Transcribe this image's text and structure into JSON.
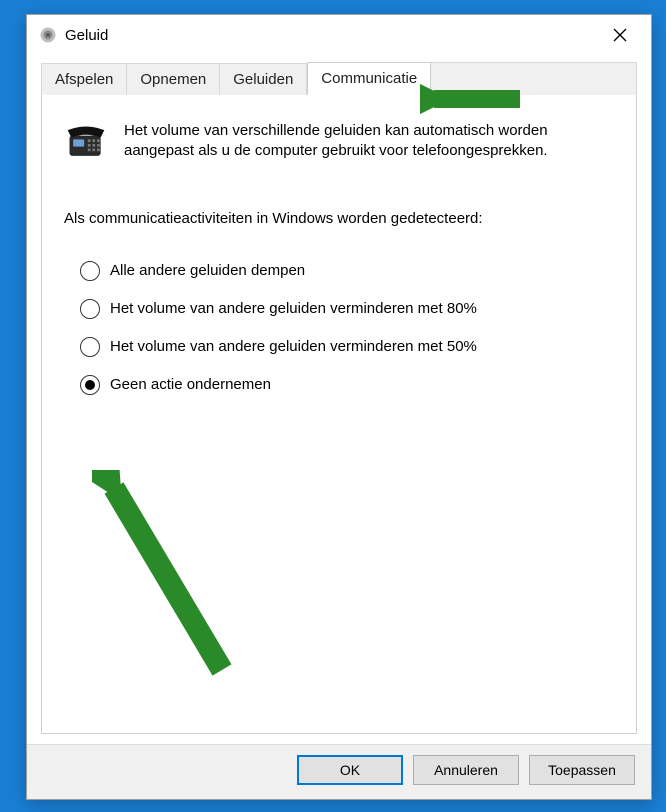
{
  "window": {
    "title": "Geluid"
  },
  "tabs": [
    {
      "label": "Afspelen",
      "active": false
    },
    {
      "label": "Opnemen",
      "active": false
    },
    {
      "label": "Geluiden",
      "active": false
    },
    {
      "label": "Communicatie",
      "active": true
    }
  ],
  "intro_text": "Het volume van verschillende geluiden kan automatisch worden aangepast als u de computer gebruikt voor telefoongesprekken.",
  "subhead": "Als communicatieactiviteiten in Windows worden gedetecteerd:",
  "options": [
    {
      "label": "Alle andere geluiden dempen",
      "checked": false
    },
    {
      "label": "Het volume van andere geluiden verminderen met 80%",
      "checked": false
    },
    {
      "label": "Het volume van andere geluiden verminderen met 50%",
      "checked": false
    },
    {
      "label": "Geen actie ondernemen",
      "checked": true
    }
  ],
  "buttons": {
    "ok": "OK",
    "cancel": "Annuleren",
    "apply": "Toepassen"
  },
  "annotations": {
    "arrow_tab": true,
    "arrow_option": true,
    "arrow_color": "#2a8a2a"
  }
}
